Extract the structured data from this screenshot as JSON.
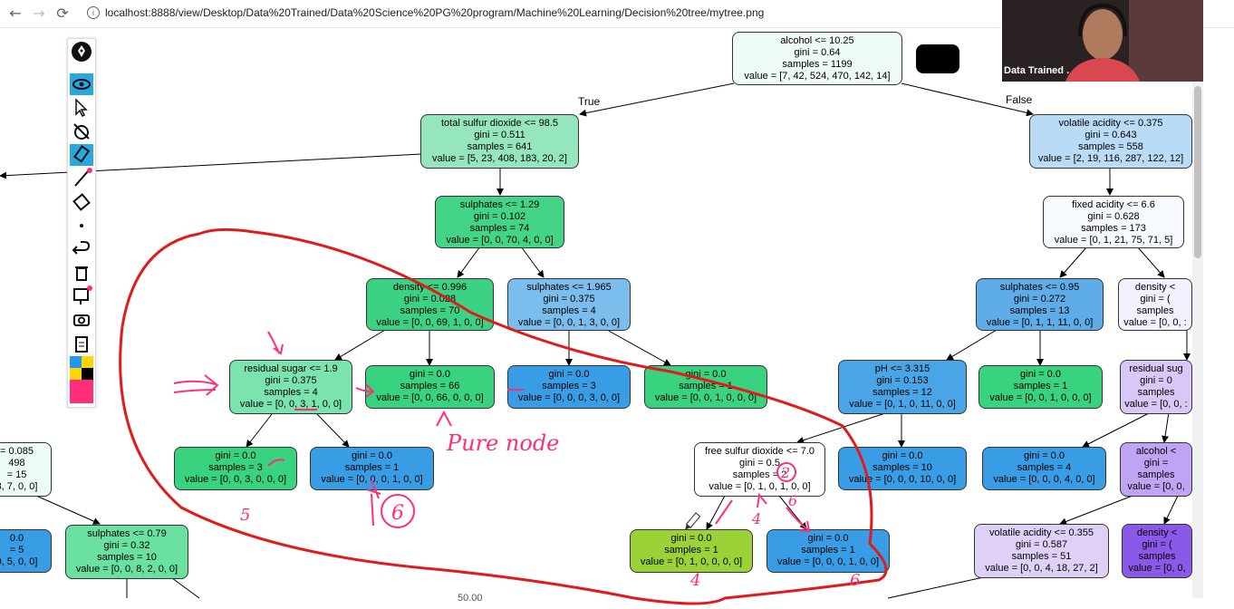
{
  "browser": {
    "url": "localhost:8888/view/Desktop/Data%20Trained/Data%20Science%20PG%20program/Machine%20Learning/Decision%20tree/mytree.png",
    "back_icon": "←",
    "forward_icon": "→",
    "reload_icon": "⟳",
    "info_icon": "i"
  },
  "webcam": {
    "label": "Data Trained ."
  },
  "tree": {
    "edge_true": "True",
    "edge_false": "False",
    "nodes": [
      {
        "id": "n0",
        "lines": [
          "alcohol <= 10.25",
          "gini = 0.64",
          "samples = 1199",
          "value = [7, 42, 524, 470, 142, 14]"
        ],
        "color": "#eefaf5"
      },
      {
        "id": "n1",
        "lines": [
          "total sulfur dioxide <= 98.5",
          "gini = 0.511",
          "samples = 641",
          "value = [5, 23, 408, 183, 20, 2]"
        ],
        "color": "#95e6bd"
      },
      {
        "id": "n2",
        "lines": [
          "volatile acidity <= 0.375",
          "gini = 0.643",
          "samples = 558",
          "value = [2, 19, 116, 287, 122, 12]"
        ],
        "color": "#b9dbf6"
      },
      {
        "id": "n3",
        "lines": [
          "sulphates <= 1.29",
          "gini = 0.102",
          "samples = 74",
          "value = [0, 0, 70, 4, 0, 0]"
        ],
        "color": "#44d486"
      },
      {
        "id": "n4",
        "lines": [
          "fixed acidity <= 6.6",
          "gini = 0.628",
          "samples = 173",
          "value = [0, 1, 21, 75, 71, 5]"
        ],
        "color": "#f6f9fe"
      },
      {
        "id": "n5",
        "lines": [
          "density <= 0.996",
          "gini = 0.028",
          "samples = 70",
          "value = [0, 0, 69, 1, 0, 0]"
        ],
        "color": "#3dd283"
      },
      {
        "id": "n6",
        "lines": [
          "sulphates <= 1.965",
          "gini = 0.375",
          "samples = 4",
          "value = [0, 0, 1, 3, 0, 0]"
        ],
        "color": "#7bbeee"
      },
      {
        "id": "n7",
        "lines": [
          "sulphates <= 0.95",
          "gini = 0.272",
          "samples = 13",
          "value = [0, 1, 1, 11, 0, 0]"
        ],
        "color": "#5eade9"
      },
      {
        "id": "n8",
        "lines": [
          "density <",
          "gini = (",
          "samples",
          "value = [0, 0, :"
        ],
        "color": "#f4f0fd"
      },
      {
        "id": "n9",
        "lines": [
          "residual sugar <= 1.9",
          "gini = 0.375",
          "samples = 4",
          "value = [0, 0, 3, 1, 0, 0]"
        ],
        "color": "#7be3ae"
      },
      {
        "id": "n10",
        "lines": [
          "",
          "gini = 0.0",
          "samples = 66",
          "value = [0, 0, 66, 0, 0, 0]"
        ],
        "color": "#39d27f"
      },
      {
        "id": "n11",
        "lines": [
          "",
          "gini = 0.0",
          "samples = 3",
          "value = [0, 0, 0, 3, 0, 0]"
        ],
        "color": "#399de5"
      },
      {
        "id": "n12",
        "lines": [
          "",
          "gini = 0.0",
          "samples = 1",
          "value = [0, 0, 1, 0, 0, 0]"
        ],
        "color": "#39d27f"
      },
      {
        "id": "n13",
        "lines": [
          "pH <= 3.315",
          "gini = 0.153",
          "samples = 12",
          "value = [0, 1, 0, 11, 0, 0]"
        ],
        "color": "#4aa5e7"
      },
      {
        "id": "n14",
        "lines": [
          "",
          "gini = 0.0",
          "samples = 1",
          "value = [0, 0, 1, 0, 0, 0]"
        ],
        "color": "#39d27f"
      },
      {
        "id": "n15",
        "lines": [
          "residual sug",
          "gini = 0",
          "samples",
          "value = [0, 0, :"
        ],
        "color": "#d9c8f7"
      },
      {
        "id": "n16",
        "lines": [
          "",
          "gini = 0.0",
          "samples = 3",
          "value = [0, 0, 3, 0, 0, 0]"
        ],
        "color": "#39d27f"
      },
      {
        "id": "n17",
        "lines": [
          "",
          "gini = 0.0",
          "samples = 1",
          "value = [0, 0, 0, 1, 0, 0]"
        ],
        "color": "#399de5"
      },
      {
        "id": "n18",
        "lines": [
          "free sulfur dioxide <= 7.0",
          "gini = 0.5",
          "samples = 2",
          "value = [0, 1, 0, 1, 0, 0]"
        ],
        "color": "#ffffff"
      },
      {
        "id": "n19",
        "lines": [
          "",
          "gini = 0.0",
          "samples = 10",
          "value = [0, 0, 0, 10, 0, 0]"
        ],
        "color": "#399de5"
      },
      {
        "id": "n20",
        "lines": [
          "",
          "gini = 0.0",
          "samples = 4",
          "value = [0, 0, 0, 4, 0, 0]"
        ],
        "color": "#399de5"
      },
      {
        "id": "n21",
        "lines": [
          "alcohol <",
          "gini =",
          "samples",
          "value = [0, 0,"
        ],
        "color": "#c0a3f2"
      },
      {
        "id": "n22",
        "lines": [
          "= 0.085",
          "498",
          "= 15",
          "8, 7, 0, 0]"
        ],
        "color": "#ecfbf3"
      },
      {
        "id": "n23",
        "lines": [
          "sulphates <= 0.79",
          "gini = 0.32",
          "samples = 10",
          "value = [0, 0, 8, 2, 0, 0]"
        ],
        "color": "#6ae0a1"
      },
      {
        "id": "n24",
        "lines": [
          "0.0",
          "= 5",
          "0, 5, 0, 0]",
          ""
        ],
        "color": "#399de5"
      },
      {
        "id": "n25",
        "lines": [
          "",
          "gini = 0.0",
          "samples = 1",
          "value = [0, 1, 0, 0, 0, 0]"
        ],
        "color": "#9bd238"
      },
      {
        "id": "n26",
        "lines": [
          "",
          "gini = 0.0",
          "samples = 1",
          "value = [0, 0, 0, 1, 0, 0]"
        ],
        "color": "#399de5"
      },
      {
        "id": "n27",
        "lines": [
          "volatile acidity <= 0.355",
          "gini = 0.587",
          "samples = 51",
          "value = [0, 0, 4, 18, 27, 2]"
        ],
        "color": "#dfd0f8"
      },
      {
        "id": "n28",
        "lines": [
          "density <",
          "gini = (",
          "samples",
          "value = [0, 0,"
        ],
        "color": "#8b59e8"
      }
    ]
  },
  "annotations": {
    "pure_node": "Pure node",
    "circled_six": "6",
    "num_4a": "4",
    "num_5": "5",
    "num_6b": "6",
    "num_4b": "4",
    "num_6c": "6",
    "circled_2": "2",
    "zoom_text": "50.00"
  },
  "colors": {
    "red_ink": "#e11b1b",
    "pink_ink": "#ff2d7a",
    "toolbar_active": "#29a8e0"
  },
  "toolbar_icons": [
    "pen-logo-icon",
    "eye-icon",
    "cursor-icon",
    "eraser-off-icon",
    "highlighter-icon",
    "line-icon",
    "eraser-icon",
    "dot-icon",
    "undo-icon",
    "trash-icon",
    "whiteboard-icon",
    "camera-icon",
    "clipboard-icon",
    "color-palette-icon"
  ]
}
